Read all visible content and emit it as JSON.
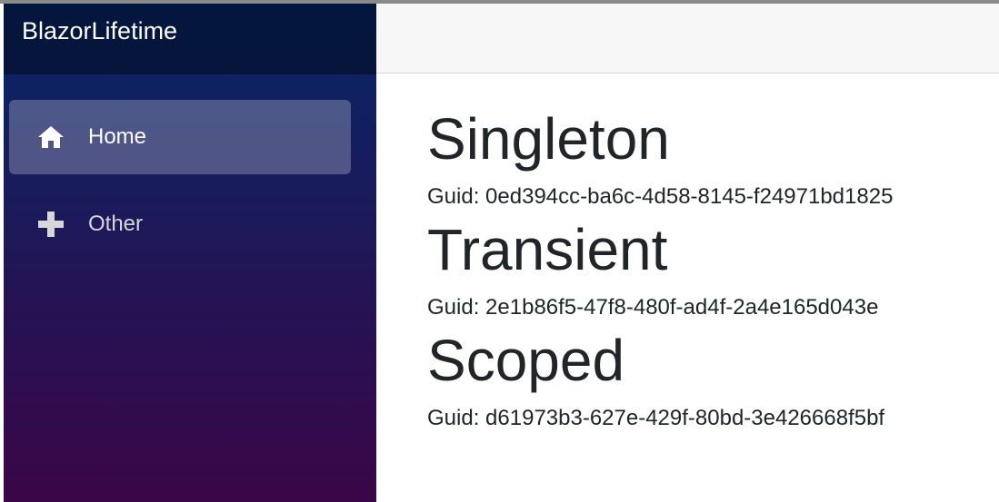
{
  "app": {
    "brand": "BlazorLifetime"
  },
  "nav": {
    "items": [
      {
        "label": "Home",
        "icon": "home-icon",
        "active": true
      },
      {
        "label": "Other",
        "icon": "plus-icon",
        "active": false
      }
    ]
  },
  "main": {
    "sections": [
      {
        "title": "Singleton",
        "guid_label": "Guid:",
        "guid": "0ed394cc-ba6c-4d58-8145-f24971bd1825"
      },
      {
        "title": "Transient",
        "guid_label": "Guid:",
        "guid": "2e1b86f5-47f8-480f-ad4f-2a4e165d043e"
      },
      {
        "title": "Scoped",
        "guid_label": "Guid:",
        "guid": "d61973b3-627e-429f-80bd-3e426668f5bf"
      }
    ]
  },
  "colors": {
    "sidebar_top": "#052767",
    "sidebar_bottom": "#3a0647",
    "top_row": "#f7f7f7",
    "text": "#212529"
  }
}
